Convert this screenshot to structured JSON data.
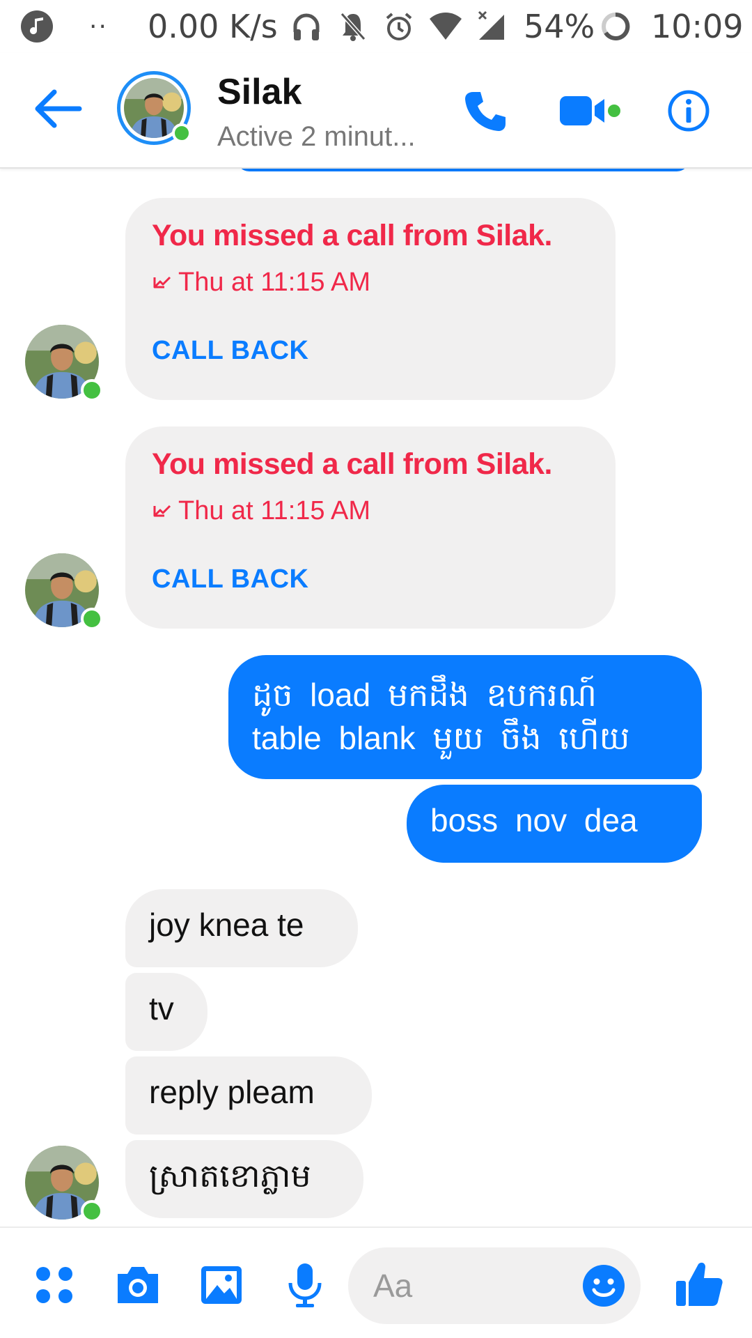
{
  "status_bar": {
    "dots": "··",
    "network_speed": "0.00 K/s",
    "battery_percent": "54%",
    "time": "10:09",
    "icons": [
      "music-icon",
      "headset-icon",
      "bell-off-icon",
      "alarm-icon",
      "wifi-icon",
      "signal-icon",
      "battery-icon"
    ]
  },
  "header": {
    "contact_name": "Silak",
    "contact_status": "Active 2 minut...",
    "online": true,
    "icons": [
      "back-arrow-icon",
      "phone-icon",
      "video-camera-icon",
      "info-icon"
    ]
  },
  "chat": {
    "missed_calls": [
      {
        "title": "You missed a call from Silak.",
        "time": "Thu at 11:15 AM",
        "action": "CALL BACK"
      },
      {
        "title": "You missed a call from Silak.",
        "time": "Thu at 11:15 AM",
        "action": "CALL BACK"
      }
    ],
    "outgoing": [
      {
        "line1": "ដូច  load មកដឹង ឧបករណ៍",
        "line2": "table blank មួយ ចឹង ហើយ"
      },
      {
        "text": "boss  nov  dea"
      }
    ],
    "incoming": [
      {
        "text": "joy knea te"
      },
      {
        "text": "tv"
      },
      {
        "text": "reply pleam"
      },
      {
        "text": "ស្រាតខោភ្លាម"
      }
    ]
  },
  "composer": {
    "placeholder": "Aa",
    "icons": [
      "apps-icon",
      "camera-icon",
      "gallery-icon",
      "microphone-icon",
      "emoji-icon",
      "thumbs-up-icon"
    ]
  },
  "colors": {
    "accent_blue": "#0a7cff",
    "missed_red": "#f02849",
    "online_green": "#44c041",
    "incoming_bubble": "#f1f0f0"
  }
}
